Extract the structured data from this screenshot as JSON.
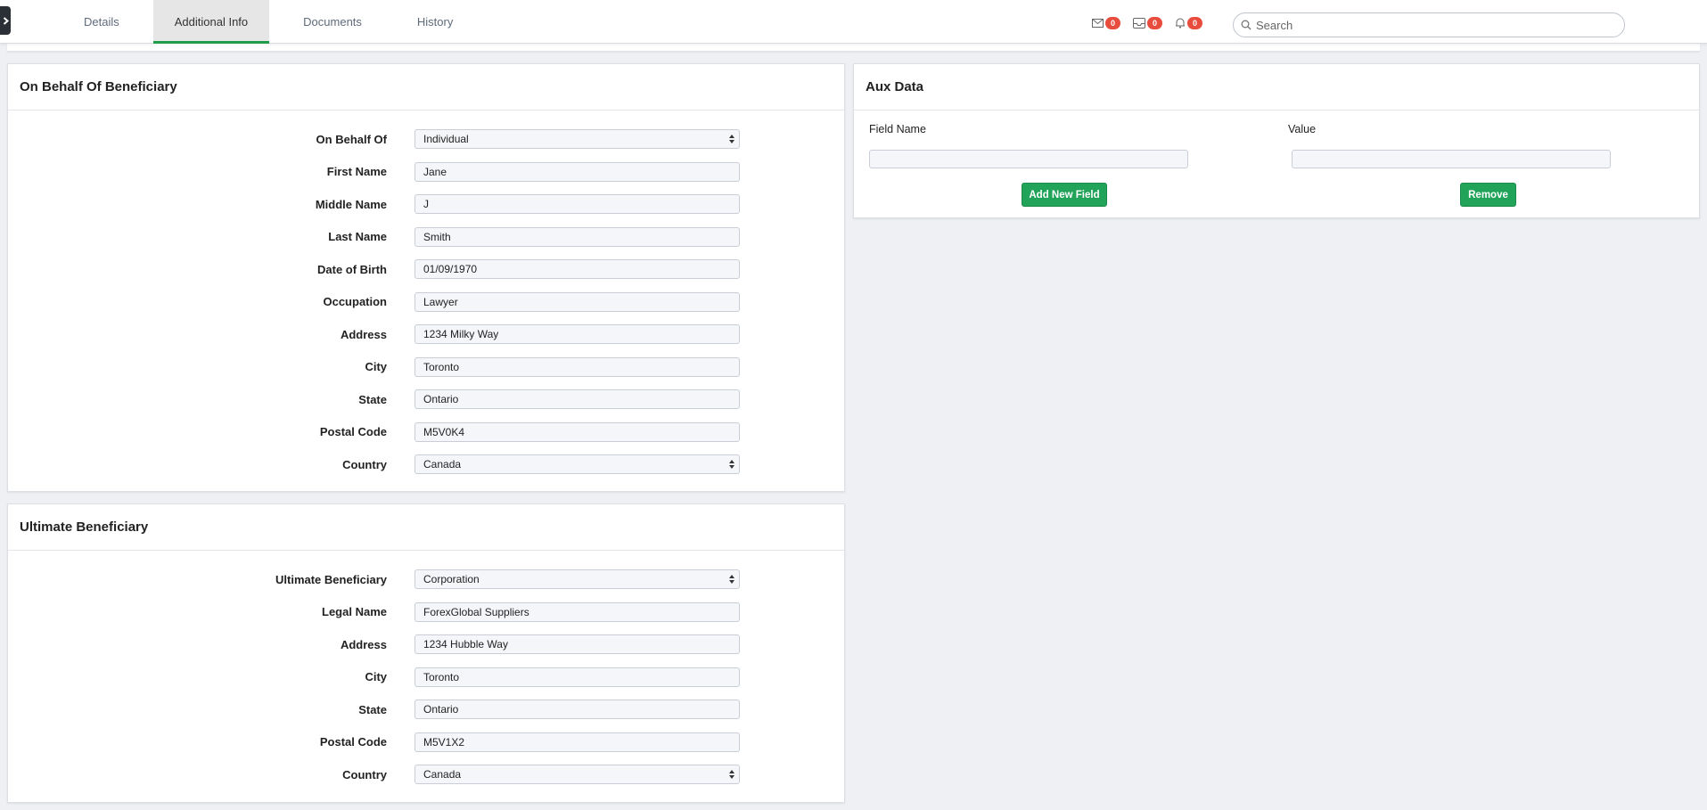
{
  "tabs": [
    {
      "label": "Details",
      "active": false
    },
    {
      "label": "Additional Info",
      "active": true
    },
    {
      "label": "Documents",
      "active": false
    },
    {
      "label": "History",
      "active": false
    }
  ],
  "notifications": {
    "messages_count": "0",
    "inbox_count": "0",
    "alerts_count": "0",
    "badge_color": "#e74c3c"
  },
  "search": {
    "placeholder": "Search",
    "value": ""
  },
  "on_behalf": {
    "title": "On Behalf Of Beneficiary",
    "fields": [
      {
        "label": "On Behalf Of",
        "value": "Individual",
        "type": "select"
      },
      {
        "label": "First Name",
        "value": "Jane",
        "type": "text"
      },
      {
        "label": "Middle Name",
        "value": "J",
        "type": "text"
      },
      {
        "label": "Last Name",
        "value": "Smith",
        "type": "text"
      },
      {
        "label": "Date of Birth",
        "value": "01/09/1970",
        "type": "text"
      },
      {
        "label": "Occupation",
        "value": "Lawyer",
        "type": "text"
      },
      {
        "label": "Address",
        "value": "1234 Milky Way",
        "type": "text"
      },
      {
        "label": "City",
        "value": "Toronto",
        "type": "text"
      },
      {
        "label": "State",
        "value": "Ontario",
        "type": "text"
      },
      {
        "label": "Postal Code",
        "value": "M5V0K4",
        "type": "text"
      },
      {
        "label": "Country",
        "value": "Canada",
        "type": "select"
      }
    ]
  },
  "ultimate": {
    "title": "Ultimate Beneficiary",
    "fields": [
      {
        "label": "Ultimate Beneficiary",
        "value": "Corporation",
        "type": "select"
      },
      {
        "label": "Legal Name",
        "value": "ForexGlobal Suppliers",
        "type": "text"
      },
      {
        "label": "Address",
        "value": "1234 Hubble Way",
        "type": "text"
      },
      {
        "label": "City",
        "value": "Toronto",
        "type": "text"
      },
      {
        "label": "State",
        "value": "Ontario",
        "type": "text"
      },
      {
        "label": "Postal Code",
        "value": "M5V1X2",
        "type": "text"
      },
      {
        "label": "Country",
        "value": "Canada",
        "type": "select"
      }
    ]
  },
  "aux": {
    "title": "Aux Data",
    "field_name_header": "Field Name",
    "value_header": "Value",
    "field_name_value": "",
    "value_value": "",
    "add_button": "Add New Field",
    "remove_button": "Remove",
    "button_color": "#22a35a"
  },
  "colors": {
    "active_tab_underline": "#1f9d4b",
    "background": "#eef0f4"
  }
}
